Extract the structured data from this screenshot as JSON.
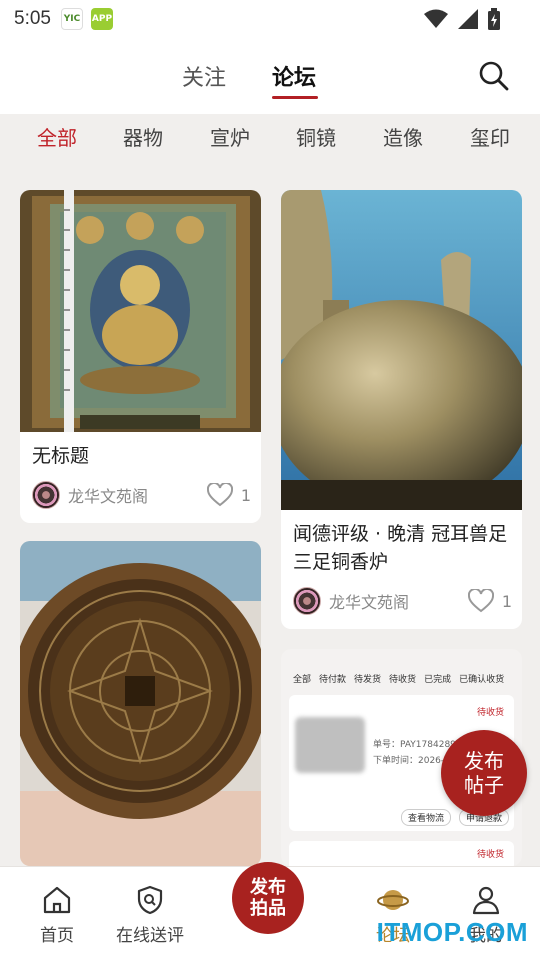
{
  "status_bar": {
    "time": "5:05",
    "badge_a": "YIC",
    "badge_b": "APP"
  },
  "header": {
    "tab_follow": "关注",
    "tab_forum": "论坛"
  },
  "categories": [
    "全部",
    "器物",
    "宣炉",
    "铜镜",
    "造像",
    "玺印"
  ],
  "active_category": 0,
  "posts": [
    {
      "title": "无标题",
      "author": "龙华文苑阁",
      "likes": "1"
    },
    {
      "title": "闻德评级 · 晚清 冠耳兽足三足铜香炉",
      "author": "龙华文苑阁",
      "likes": "1"
    }
  ],
  "order_screenshot": {
    "tabs": [
      "全部",
      "待付款",
      "待发货",
      "待收货",
      "已完成",
      "已确认收货"
    ],
    "status1": "待收货",
    "order_no": "单号：PAY17842896",
    "order_time": "下单时间：2026-07-",
    "btn_logistics": "查看物流",
    "btn_refund": "申请退款",
    "status2": "待收货"
  },
  "fab": {
    "line1": "发布",
    "line2": "帖子"
  },
  "bottom_nav": {
    "home": "首页",
    "appraisal": "在线送评",
    "center_line1": "发布",
    "center_line2": "拍品",
    "forum": "论坛",
    "mine": "我的"
  },
  "watermark": "ITMOP.COM",
  "colors": {
    "accent": "#c0232a",
    "fab": "#a8221f",
    "active_nav": "#b8862b"
  }
}
